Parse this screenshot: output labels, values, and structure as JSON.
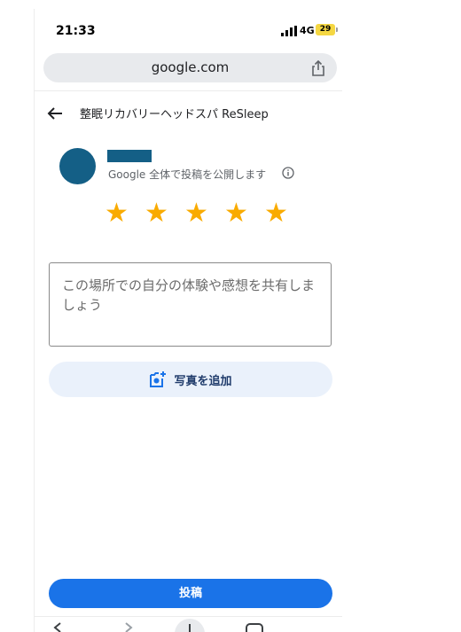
{
  "status_bar": {
    "time": "21:33",
    "network": "4G",
    "battery": "29"
  },
  "browser": {
    "url": "google.com"
  },
  "header": {
    "place_name": "整眠リカバリーヘッドスパ ReSleep"
  },
  "user": {
    "publish_note": "Google 全体で投稿を公開します"
  },
  "rating": {
    "stars_total": 5,
    "stars_selected": 5,
    "star_glyph": "★"
  },
  "review": {
    "placeholder": "この場所での自分の体験や感想を共有しましょう"
  },
  "actions": {
    "add_photo_label": "写真を追加",
    "post_label": "投稿"
  },
  "colors": {
    "accent": "#1a73e8",
    "star": "#f9ab00",
    "avatar": "#145f86",
    "photo_button_bg": "#eaf1fb"
  }
}
